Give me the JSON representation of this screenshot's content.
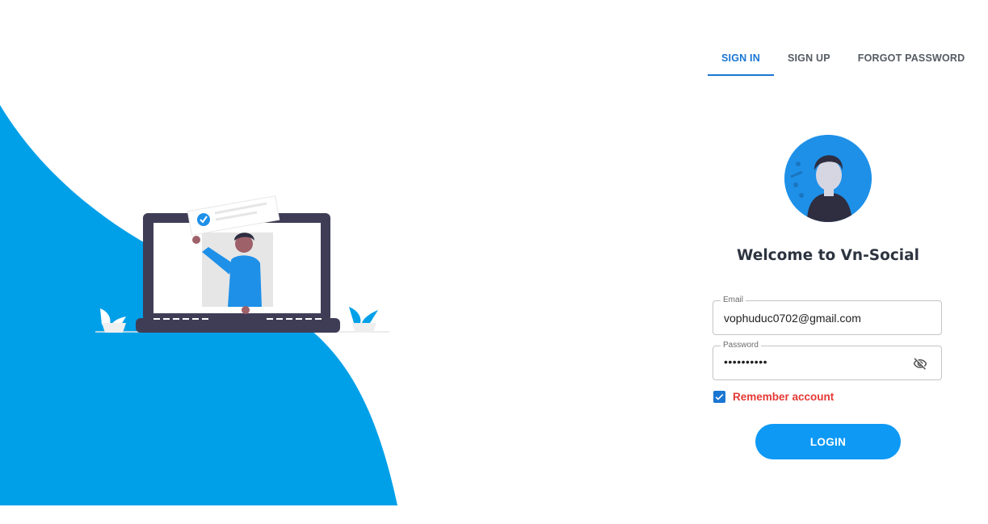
{
  "tabs": [
    {
      "label": "SIGN IN",
      "active": true
    },
    {
      "label": "SIGN UP",
      "active": false
    },
    {
      "label": "FORGOT PASSWORD",
      "active": false
    }
  ],
  "welcome_title": "Welcome to Vn-Social",
  "form": {
    "email": {
      "label": "Email",
      "value": "vophuduc0702@gmail.com"
    },
    "password": {
      "label": "Password",
      "value": "••••••••••"
    },
    "remember": {
      "label": "Remember account",
      "checked": true
    },
    "login_label": "LOGIN"
  },
  "colors": {
    "accent": "#1976d2",
    "hero_blue": "#00a0e9",
    "login_button": "#0e99f5",
    "remember_text": "#e53935"
  },
  "icons": {
    "password_toggle": "eye-off-icon",
    "checkbox": "checkmark-icon"
  }
}
